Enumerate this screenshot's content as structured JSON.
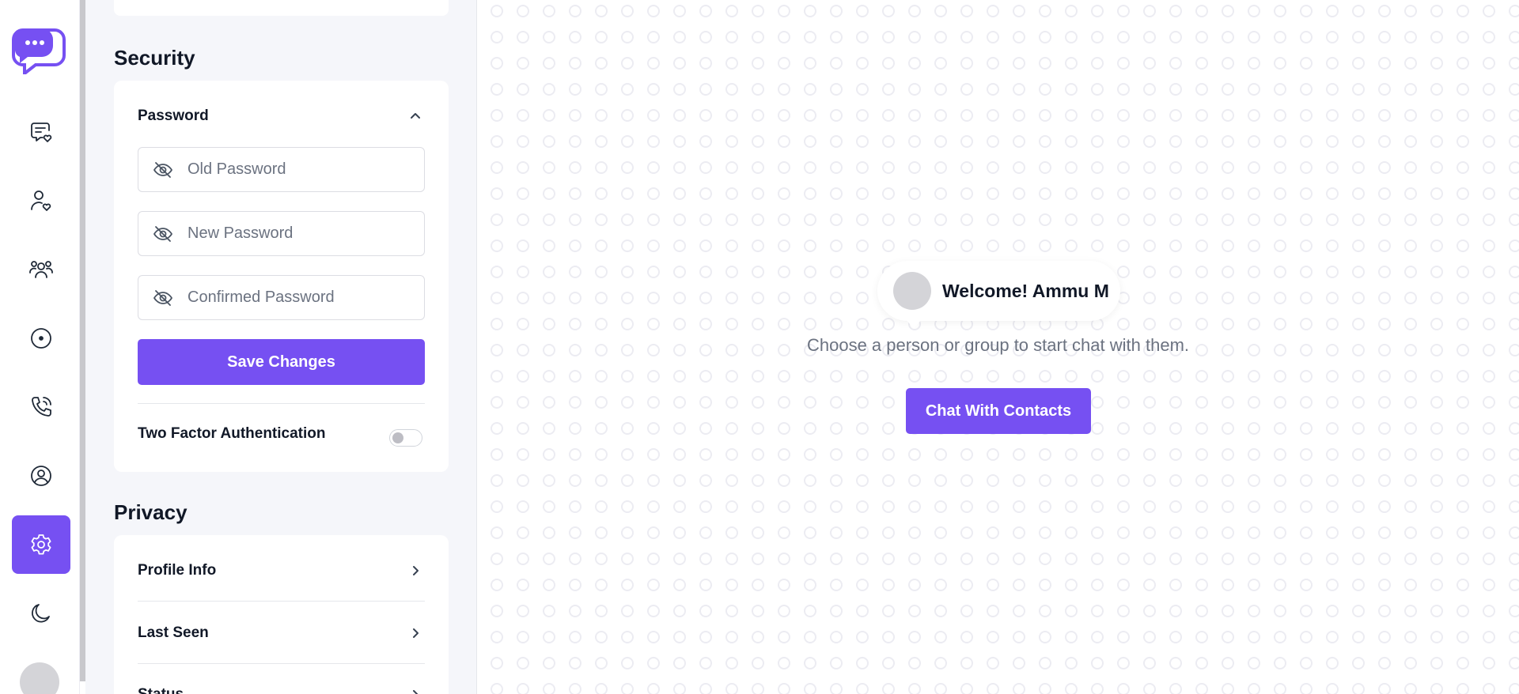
{
  "nav": {
    "items": [
      {
        "icon": "chat-heart-icon",
        "active": false
      },
      {
        "icon": "user-heart-icon",
        "active": false
      },
      {
        "icon": "group-icon",
        "active": false
      },
      {
        "icon": "status-icon",
        "active": false
      },
      {
        "icon": "phone-call-icon",
        "active": false
      },
      {
        "icon": "user-circle-icon",
        "active": false
      },
      {
        "icon": "settings-gear-icon",
        "active": true
      },
      {
        "icon": "moon-icon",
        "active": false
      }
    ]
  },
  "security": {
    "title": "Security",
    "password_heading": "Password",
    "old_password_placeholder": "Old Password",
    "new_password_placeholder": "New Password",
    "confirm_password_placeholder": "Confirmed Password",
    "save_label": "Save Changes",
    "two_factor_label": "Two Factor Authentication",
    "two_factor_enabled": false
  },
  "privacy": {
    "title": "Privacy",
    "items": [
      {
        "label": "Profile Info"
      },
      {
        "label": "Last Seen"
      },
      {
        "label": "Status"
      }
    ]
  },
  "welcome": {
    "greeting": "Welcome! Ammu M",
    "subtitle": "Choose a person or group to start chat with them.",
    "cta_label": "Chat With Contacts"
  },
  "colors": {
    "accent": "#7650f2",
    "panel_bg": "#f5f6fa",
    "pattern": "#ececf2"
  }
}
